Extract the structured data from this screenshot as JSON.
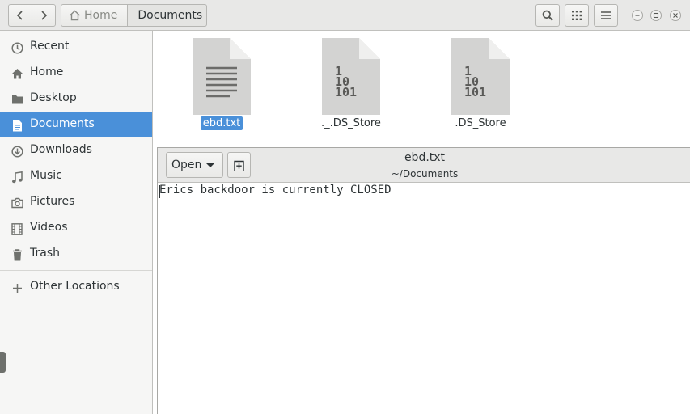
{
  "header": {
    "breadcrumbs": [
      {
        "label": "Home",
        "icon": "home-icon"
      },
      {
        "label": "Documents"
      }
    ]
  },
  "sidebar": {
    "items": [
      {
        "label": "Recent",
        "icon": "clock-icon"
      },
      {
        "label": "Home",
        "icon": "home-icon"
      },
      {
        "label": "Desktop",
        "icon": "folder-icon"
      },
      {
        "label": "Documents",
        "icon": "document-icon",
        "active": true
      },
      {
        "label": "Downloads",
        "icon": "download-icon"
      },
      {
        "label": "Music",
        "icon": "music-icon"
      },
      {
        "label": "Pictures",
        "icon": "camera-icon"
      },
      {
        "label": "Videos",
        "icon": "film-icon"
      },
      {
        "label": "Trash",
        "icon": "trash-icon"
      }
    ],
    "other_locations": {
      "label": "Other Locations",
      "icon": "plus-icon"
    }
  },
  "files": [
    {
      "name": "ebd.txt",
      "icon": "text-file-icon",
      "selected": true
    },
    {
      "name": "._.DS_Store",
      "icon": "binary-file-icon",
      "selected": false
    },
    {
      "name": ".DS_Store",
      "icon": "binary-file-icon",
      "selected": false
    }
  ],
  "viewer": {
    "open_label": "Open",
    "title": "ebd.txt",
    "subtitle": "~/Documents",
    "content": "Erics backdoor is currently CLOSED"
  },
  "colors": {
    "accent": "#4a90d9",
    "sidebar_bg": "#f6f6f5",
    "header_bg": "#e8e8e7"
  }
}
